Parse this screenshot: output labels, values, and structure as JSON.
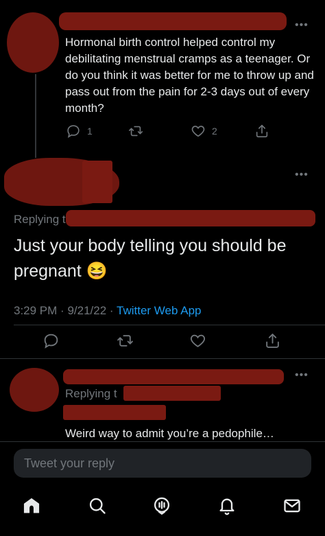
{
  "tweet1": {
    "more_label": "•••",
    "text": "Hormonal birth control helped control my debilitating menstrual cramps as a teenager. Or do you think it was better for me to throw up and pass out from the pain for 2-3 days out of every month?",
    "reply_count": "1",
    "like_count": "2"
  },
  "main_tweet": {
    "more_label": "•••",
    "replying_prefix": "Replying to",
    "text": "Just your body telling you should be pregnant 😆",
    "time": "3:29 PM",
    "date": "9/21/22",
    "separator": "·",
    "source": "Twitter Web App"
  },
  "reply_tweet": {
    "more_label": "•••",
    "replying_prefix": "Replying t",
    "text": "Weird way to admit you’re a pedophile…"
  },
  "composer": {
    "placeholder": "Tweet your reply"
  },
  "colors": {
    "background": "#000000",
    "text": "#e7e9ea",
    "muted": "#71767b",
    "link": "#1d9bf0",
    "redaction": "#7a1a12"
  },
  "icons": [
    "reply-icon",
    "retweet-icon",
    "like-icon",
    "share-icon",
    "home-icon",
    "search-icon",
    "spaces-icon",
    "notifications-icon",
    "messages-icon"
  ]
}
